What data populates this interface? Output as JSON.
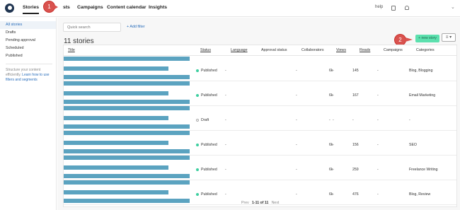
{
  "nav": {
    "tabs": [
      "Stories",
      "sts",
      "Campaigns",
      "Content calendar",
      "Insights"
    ],
    "help": "help",
    "callout1": "1"
  },
  "sidebar": {
    "items": [
      "All stories",
      "Drafts",
      "Pending approval",
      "Scheduled",
      "Published"
    ],
    "help_text": "Structure your content efficiently.",
    "help_link": "Learn how to use filters and segments"
  },
  "toolbar": {
    "search_placeholder": "Quick search",
    "add_filter": "+ Add filter",
    "count": "11 stories",
    "new_story": "+ new story",
    "callout2": "2",
    "view_icon": "≡ ▾"
  },
  "table": {
    "headers": {
      "title": "Title",
      "status": "Status",
      "language": "Language",
      "approval": "Approval status",
      "collaborators": "Collaborators",
      "views": "Views",
      "reads": "Reads",
      "campaigns": "Campaigns",
      "categories": "Categories"
    },
    "rows": [
      {
        "status": "Published",
        "status_color": "#3ecfa0",
        "language": "-",
        "approval": "-",
        "collaborators": "-",
        "views": "6k",
        "reads": "145",
        "campaigns": "-",
        "categories": "Blog, Blogging"
      },
      {
        "status": "Published",
        "status_color": "#3ecfa0",
        "language": "-",
        "approval": "-",
        "collaborators": "-",
        "views": "6k",
        "reads": "167",
        "campaigns": "-",
        "categories": "Email Marketing"
      },
      {
        "status": "Draft",
        "status_color": "#ffffff",
        "language": "-",
        "approval": "-",
        "collaborators": "-",
        "views": "-",
        "reads": "-",
        "campaigns": "-",
        "categories": "-"
      },
      {
        "status": "Published",
        "status_color": "#3ecfa0",
        "language": "-",
        "approval": "-",
        "collaborators": "-",
        "views": "6k",
        "reads": "156",
        "campaigns": "-",
        "categories": "SEO"
      },
      {
        "status": "Published",
        "status_color": "#3ecfa0",
        "language": "-",
        "approval": "-",
        "collaborators": "-",
        "views": "6k",
        "reads": "259",
        "campaigns": "-",
        "categories": "Freelance Writing"
      },
      {
        "status": "Published",
        "status_color": "#3ecfa0",
        "language": "-",
        "approval": "-",
        "collaborators": "-",
        "views": "6k",
        "reads": "476",
        "campaigns": "-",
        "categories": "Blog, Review"
      }
    ]
  },
  "pager": {
    "prev": "Prev",
    "range": "1-11 of 11",
    "next": "Next"
  },
  "colors": {
    "accent": "#2a6ebb",
    "new_story": "#5ce0ae",
    "callout": "#d9534f",
    "title_bar": "#5ba3c0"
  }
}
